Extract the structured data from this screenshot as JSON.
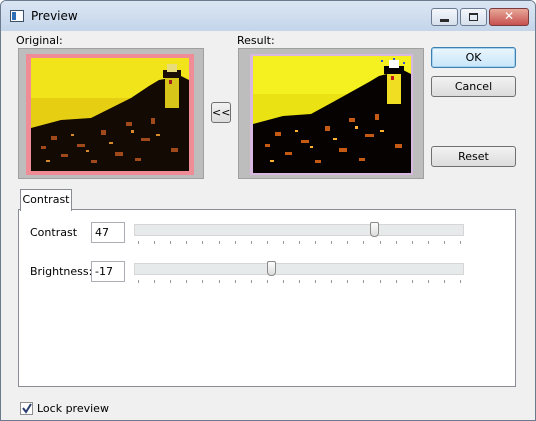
{
  "window": {
    "title": "Preview"
  },
  "titlebar_buttons": {
    "close_glyph": "✕"
  },
  "original": {
    "label": "Original:"
  },
  "result": {
    "label": "Result:"
  },
  "copy_button": {
    "label": "<<"
  },
  "buttons": {
    "ok": "OK",
    "cancel": "Cancel",
    "reset": "Reset"
  },
  "tabs": [
    {
      "label": "Contrast"
    }
  ],
  "sliders": [
    {
      "label": "Contrast",
      "value": "47",
      "min": -100,
      "max": 100,
      "position": 47
    },
    {
      "label": "Brightness:",
      "value": "-17",
      "min": -100,
      "max": 100,
      "position": -17
    }
  ],
  "lock_preview": {
    "label": "Lock preview",
    "checked": true
  },
  "colors": {
    "original_frame": "#f08c96",
    "result_frame": "#d8b8e0",
    "sky_original": "#f1e41a",
    "sky_result": "#f5f020",
    "default_button_border": "#3c7fb1"
  }
}
